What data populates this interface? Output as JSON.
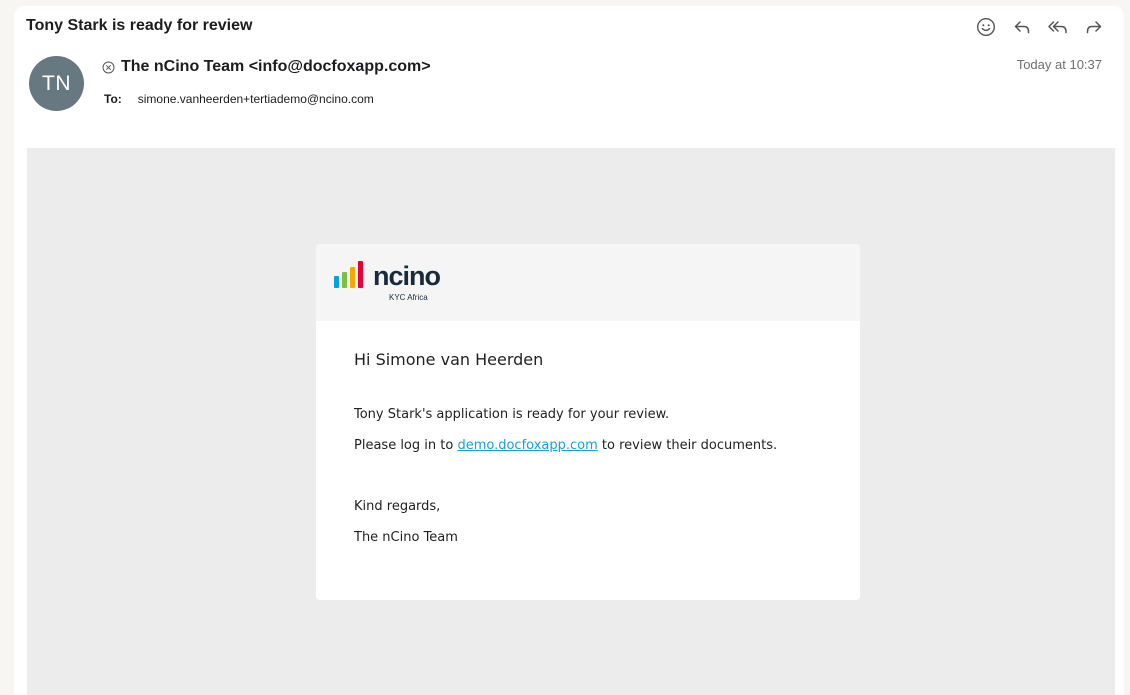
{
  "email": {
    "subject": "Tony Stark is ready for review",
    "sender": "The nCino Team <info@docfoxapp.com>",
    "sender_initials": "TN",
    "to_label": "To:",
    "to_address": "simone.vanheerden+tertiademo@ncino.com",
    "timestamp": "Today at 10:37"
  },
  "actions": [
    {
      "name": "emoji-reaction",
      "icon": "smiley-icon"
    },
    {
      "name": "reply",
      "icon": "reply-icon"
    },
    {
      "name": "reply-all",
      "icon": "reply-all-icon"
    },
    {
      "name": "forward",
      "icon": "forward-icon"
    }
  ],
  "body": {
    "logo": {
      "word": "ncino",
      "sub": "KYC Africa",
      "bar_colors": [
        "#00a3e0",
        "#7ac143",
        "#f7a800",
        "#e4003b"
      ]
    },
    "greeting": "Hi Simone van Heerden",
    "line1": "Tony Stark's application is ready for your review.",
    "line2_before": "Please log in to",
    "line2_link": "demo.docfoxapp.com",
    "line2_after": "to review their documents.",
    "closing": "Kind regards,",
    "signature": "The nCino Team"
  },
  "colors": {
    "avatar": "#677880",
    "link": "#1a9fd6",
    "body_background": "#ececec"
  }
}
